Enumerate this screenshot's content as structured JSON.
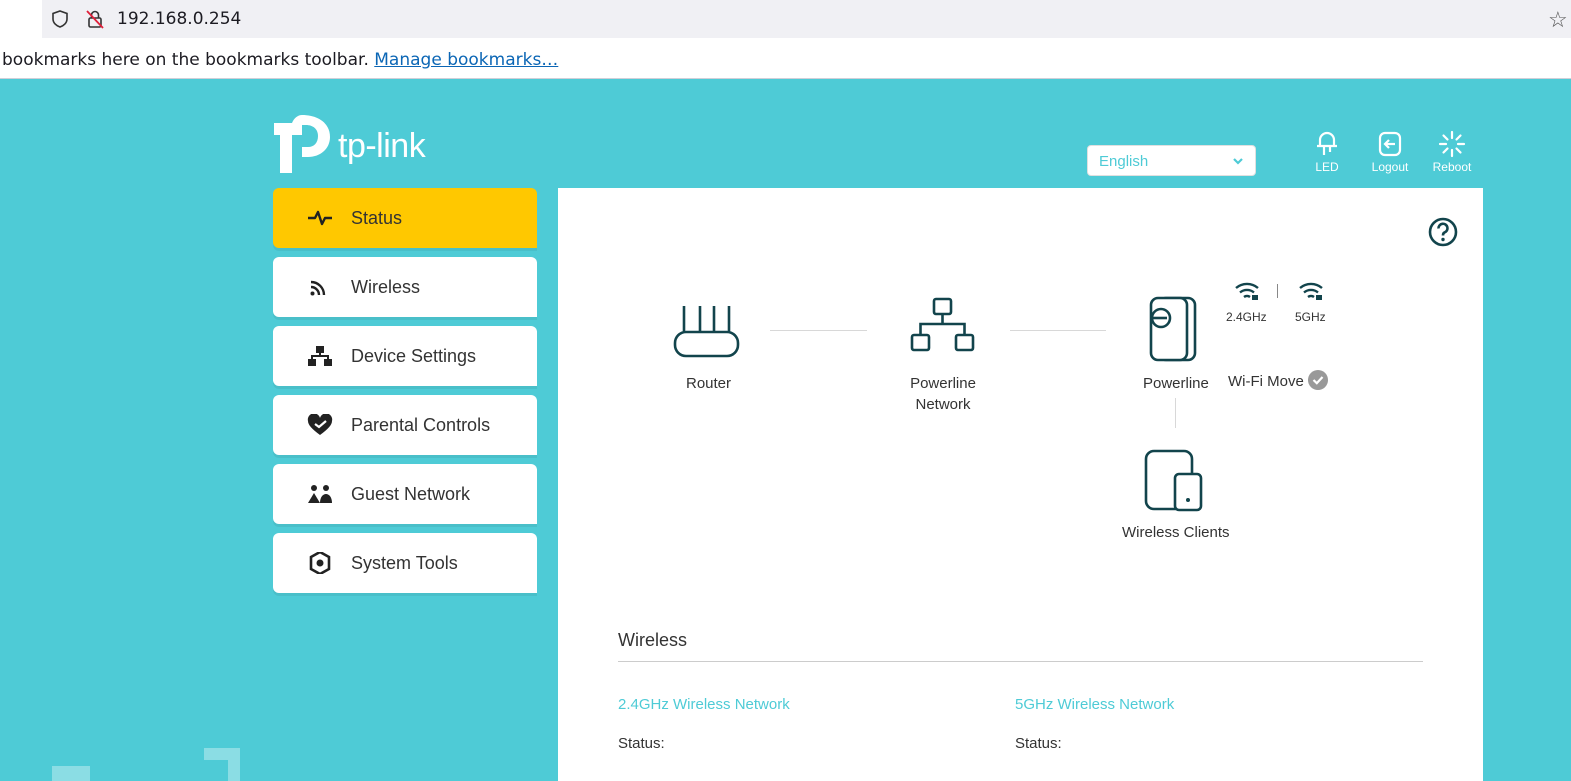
{
  "browser": {
    "url": "192.168.0.254",
    "bookmarks_message": "bookmarks here on the bookmarks toolbar.",
    "manage_bookmarks": "Manage bookmarks…"
  },
  "header": {
    "brand": "tp-link",
    "language": "English",
    "buttons": {
      "led": "LED",
      "logout": "Logout",
      "reboot": "Reboot"
    }
  },
  "sidebar": {
    "items": [
      {
        "label": "Status",
        "icon": "pulse-icon",
        "active": true
      },
      {
        "label": "Wireless",
        "icon": "wifi-signal-icon"
      },
      {
        "label": "Device Settings",
        "icon": "network-icon"
      },
      {
        "label": "Parental Controls",
        "icon": "heart-shield-icon"
      },
      {
        "label": "Guest Network",
        "icon": "guests-icon"
      },
      {
        "label": "System Tools",
        "icon": "gear-icon"
      }
    ]
  },
  "topology": {
    "router": "Router",
    "powerline_network_1": "Powerline",
    "powerline_network_2": "Network",
    "powerline": "Powerline",
    "band_24": "2.4GHz",
    "band_5": "5GHz",
    "wifi_move": "Wi-Fi Move",
    "wireless_clients": "Wireless Clients"
  },
  "wireless_section": {
    "title": "Wireless",
    "net_24": "2.4GHz Wireless Network",
    "net_5": "5GHz Wireless Network",
    "status_label_24": "Status:",
    "status_label_5": "Status:"
  },
  "colors": {
    "accent": "#4ecbd6",
    "active_menu": "#ffc800",
    "icon_dark": "#12444c"
  }
}
